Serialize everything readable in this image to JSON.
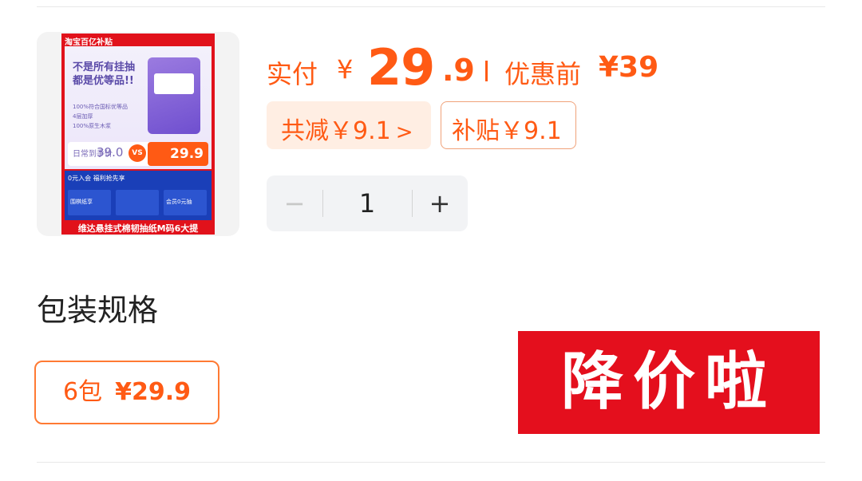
{
  "product": {
    "image": {
      "badge": "淘宝百亿补贴",
      "headline_1": "不是所有挂抽",
      "headline_2": "都是优等品!!",
      "bullet_1": "100%符合国标优等品",
      "bullet_2": "4层加厚",
      "bullet_3": "100%原生木浆",
      "old_price_label": "日常到手价",
      "old_price": "39.0",
      "vs": "VS",
      "new_price": "29.9",
      "row_1": "0元入会 福利抢先享",
      "tile_1": "围棋纸享",
      "tile_2": "会员0元抽",
      "bottom_text": "维达悬挂式棉韧抽纸M码6大提"
    }
  },
  "price": {
    "label": "实付",
    "currency": "¥",
    "integer": "29",
    "decimal": ".9",
    "before_label": "优惠前",
    "before_value": "¥39"
  },
  "discounts": {
    "total_reduce": "共减￥9.1",
    "total_reduce_chevron": ">",
    "subsidy": "补贴￥9.1"
  },
  "quantity": {
    "minus": "−",
    "value": "1",
    "plus": "+"
  },
  "spec": {
    "title": "包装规格",
    "option_name": "6包",
    "option_price": "¥29.9"
  },
  "promo": {
    "text": "降价啦"
  },
  "colors": {
    "accent": "#ff5a14",
    "promo_red": "#e40f1d",
    "chip_bg": "#ffeee3"
  }
}
